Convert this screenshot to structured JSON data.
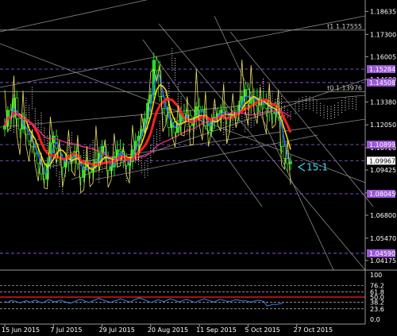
{
  "chart_data": {
    "type": "line",
    "instrument_style": "forex candlestick chart with moving averages, ichimoku cloud, fibonacci/trend lines and oscillator sub-window",
    "background": "#000000",
    "price_axis": {
      "range": [
        1.038,
        1.193
      ],
      "ticks": [
        "1.18635",
        "1.17300",
        "1.16005",
        "1.14680",
        "1.13380",
        "1.12050",
        "1.10720",
        "1.09425",
        "1.08100",
        "1.06800",
        "1.05470",
        "1.04175"
      ]
    },
    "time_axis": {
      "labels": [
        "15 Jun 2015",
        "7 Jul 2015",
        "29 Jul 2015",
        "20 Aug 2015",
        "11 Sep 2015",
        "5 Oct 2015",
        "27 Oct 2015"
      ],
      "label_index": [
        0,
        16,
        32,
        48,
        64,
        80,
        96
      ]
    },
    "level_boxes": [
      {
        "text": "1.15284",
        "value": 1.15284,
        "fill": "#9b59d6"
      },
      {
        "text": "1.14508",
        "value": 1.14508,
        "fill": "#9b59d6"
      },
      {
        "text": "1.10899",
        "value": 1.10899,
        "fill": "#9b59d6"
      },
      {
        "text": "1.09967",
        "value": 1.09967,
        "fill": "#ffffff"
      },
      {
        "text": "1.08045",
        "value": 1.08045,
        "fill": "#9b59d6"
      },
      {
        "text": "1.04590",
        "value": 1.0459,
        "fill": "#9b59d6"
      }
    ],
    "target_labels": [
      {
        "text": "t1 1.17555",
        "value": 1.17555
      },
      {
        "text": "t0 1.13976",
        "value": 1.13976
      }
    ],
    "annotation": {
      "text": "15:1",
      "color": "#40e0f0"
    },
    "close_series": [
      1.12,
      1.129,
      1.125,
      1.136,
      1.124,
      1.118,
      1.123,
      1.115,
      1.111,
      1.108,
      1.104,
      1.098,
      1.092,
      1.089,
      1.098,
      1.11,
      1.114,
      1.107,
      1.101,
      1.096,
      1.101,
      1.099,
      1.102,
      1.105,
      1.098,
      1.09,
      1.096,
      1.098,
      1.093,
      1.096,
      1.099,
      1.104,
      1.108,
      1.102,
      1.094,
      1.096,
      1.102,
      1.106,
      1.105,
      1.1,
      1.097,
      1.099,
      1.106,
      1.111,
      1.114,
      1.118,
      1.124,
      1.133,
      1.138,
      1.158,
      1.152,
      1.137,
      1.13,
      1.126,
      1.119,
      1.122,
      1.116,
      1.121,
      1.127,
      1.124,
      1.126,
      1.12,
      1.123,
      1.131,
      1.129,
      1.126,
      1.12,
      1.117,
      1.123,
      1.125,
      1.127,
      1.129,
      1.128,
      1.124,
      1.125,
      1.126,
      1.127,
      1.132,
      1.137,
      1.141,
      1.133,
      1.137,
      1.136,
      1.132,
      1.133,
      1.135,
      1.13,
      1.128,
      1.127,
      1.129,
      1.125,
      1.108,
      1.101,
      1.098,
      1.099
    ],
    "moving_averages": [
      {
        "color": "#3060ff"
      },
      {
        "color": "#ffd400"
      },
      {
        "color": "#ff2020"
      },
      {
        "color": "#cc2a7a"
      }
    ],
    "oscillator": {
      "range": [
        0,
        100
      ],
      "ticks": [
        "100",
        "76.2",
        "61.8",
        "50.0",
        "38.2",
        "23.6",
        "0.0"
      ],
      "values": [
        40,
        38,
        42,
        41,
        39,
        37,
        40,
        42,
        38,
        41,
        43,
        39,
        37,
        40,
        44,
        42,
        39,
        41,
        43,
        40,
        38,
        36,
        39,
        42,
        45,
        43,
        40,
        38,
        41,
        44,
        47,
        45,
        42,
        40,
        38,
        41,
        43,
        46,
        44,
        41,
        39,
        42,
        45,
        48,
        46,
        43,
        40,
        38,
        41,
        44,
        42,
        40,
        43,
        46,
        44,
        41,
        39,
        42,
        45,
        43,
        40,
        38,
        41,
        44,
        46,
        43,
        41,
        39,
        42,
        45,
        43,
        41,
        40,
        42,
        44,
        43,
        41,
        42,
        40,
        39,
        41,
        43,
        42,
        40,
        30,
        32,
        34,
        33,
        35,
        36
      ]
    }
  }
}
